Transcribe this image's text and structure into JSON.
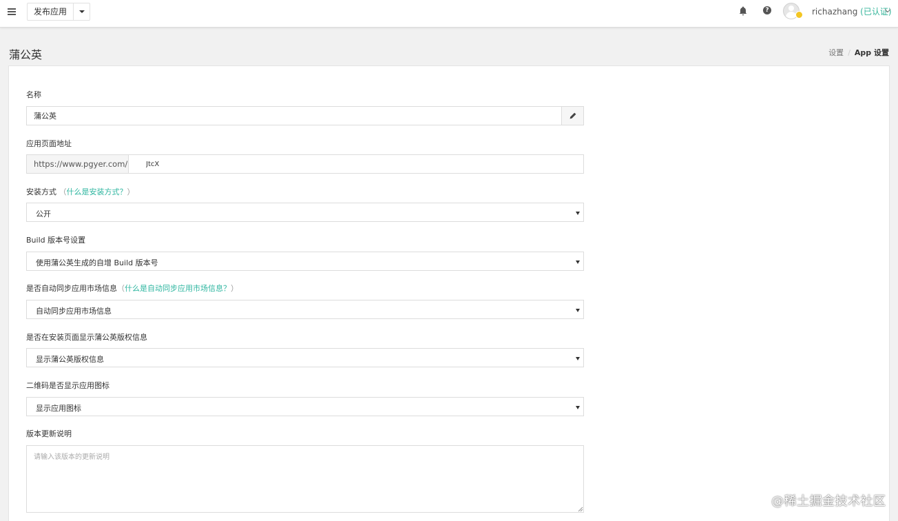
{
  "topbar": {
    "publish_label": "发布应用",
    "help_glyph": "?",
    "user": {
      "name": "richazhang",
      "status": "(已认证)"
    }
  },
  "page": {
    "title": "蒲公英",
    "breadcrumb": {
      "parent": "设置",
      "separator": "/",
      "current": "App 设置"
    }
  },
  "form": {
    "name": {
      "label": "名称",
      "value": "蒲公英"
    },
    "url": {
      "label": "应用页面地址",
      "prefix": "https://www.pgyer.com/",
      "value": "JtcX"
    },
    "install_method": {
      "label": "安装方式",
      "paren_open": "（",
      "help_link": "什么是安装方式？",
      "paren_close": "）",
      "selected": "公开"
    },
    "build_version": {
      "label": "Build 版本号设置",
      "selected": "使用蒲公英生成的自增 Build 版本号"
    },
    "sync_market": {
      "label": "是否自动同步应用市场信息",
      "paren_open": "（",
      "help_link": "什么是自动同步应用市场信息？",
      "paren_close": "）",
      "selected": "自动同步应用市场信息"
    },
    "copyright": {
      "label": "是否在安装页面显示蒲公英版权信息",
      "selected": "显示蒲公英版权信息"
    },
    "qr_icon": {
      "label": "二维码是否显示应用图标",
      "selected": "显示应用图标"
    },
    "release_notes": {
      "label": "版本更新说明",
      "placeholder": "请输入该版本的更新说明"
    }
  },
  "watermark": "@稀土掘金技术社区",
  "colors": {
    "accent": "#2eb6a0",
    "verified": "#35b59b",
    "badge": "#f3c623"
  },
  "icons": [
    "menu-icon",
    "caret-down-icon",
    "bell-icon",
    "help-icon",
    "avatar",
    "chevron-down-icon",
    "pencil-icon"
  ]
}
